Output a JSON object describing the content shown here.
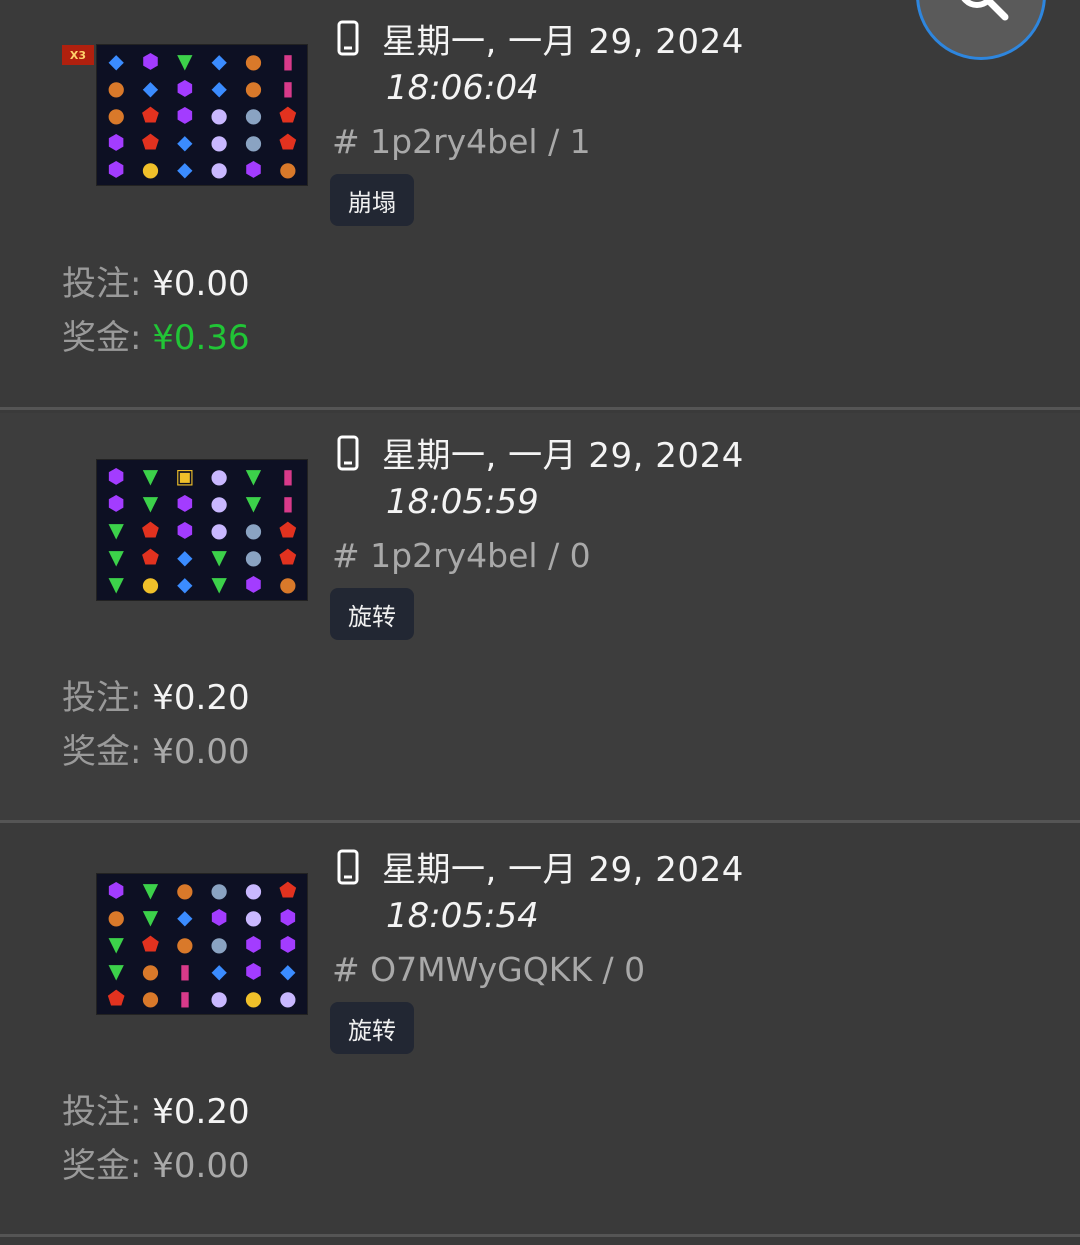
{
  "records": [
    {
      "date": "星期一, 一月 29, 2024",
      "time": "18:06:04",
      "round_id": "# 1p2ry4bel / 1",
      "tag": "崩塌",
      "bet_label": "投注:",
      "bet_value": "¥0.00",
      "win_label": "奖金:",
      "win_value": "¥0.36",
      "multiplier_badge": "X3"
    },
    {
      "date": "星期一, 一月 29, 2024",
      "time": "18:05:59",
      "round_id": "# 1p2ry4bel / 0",
      "tag": "旋转",
      "bet_label": "投注:",
      "bet_value": "¥0.20",
      "win_label": "奖金:",
      "win_value": "¥0.00"
    },
    {
      "date": "星期一, 一月 29, 2024",
      "time": "18:05:54",
      "round_id": "# O7MWyGQKK / 0",
      "tag": "旋转",
      "bet_label": "投注:",
      "bet_value": "¥0.20",
      "win_label": "奖金:",
      "win_value": "¥0.00"
    }
  ],
  "icons": {
    "device": "mobile-phone-icon",
    "search": "search-icon"
  },
  "colors": {
    "background": "#3a3a3a",
    "win_positive": "#21c536",
    "fab_ring": "#2e86de",
    "tag_bg": "#222733"
  }
}
